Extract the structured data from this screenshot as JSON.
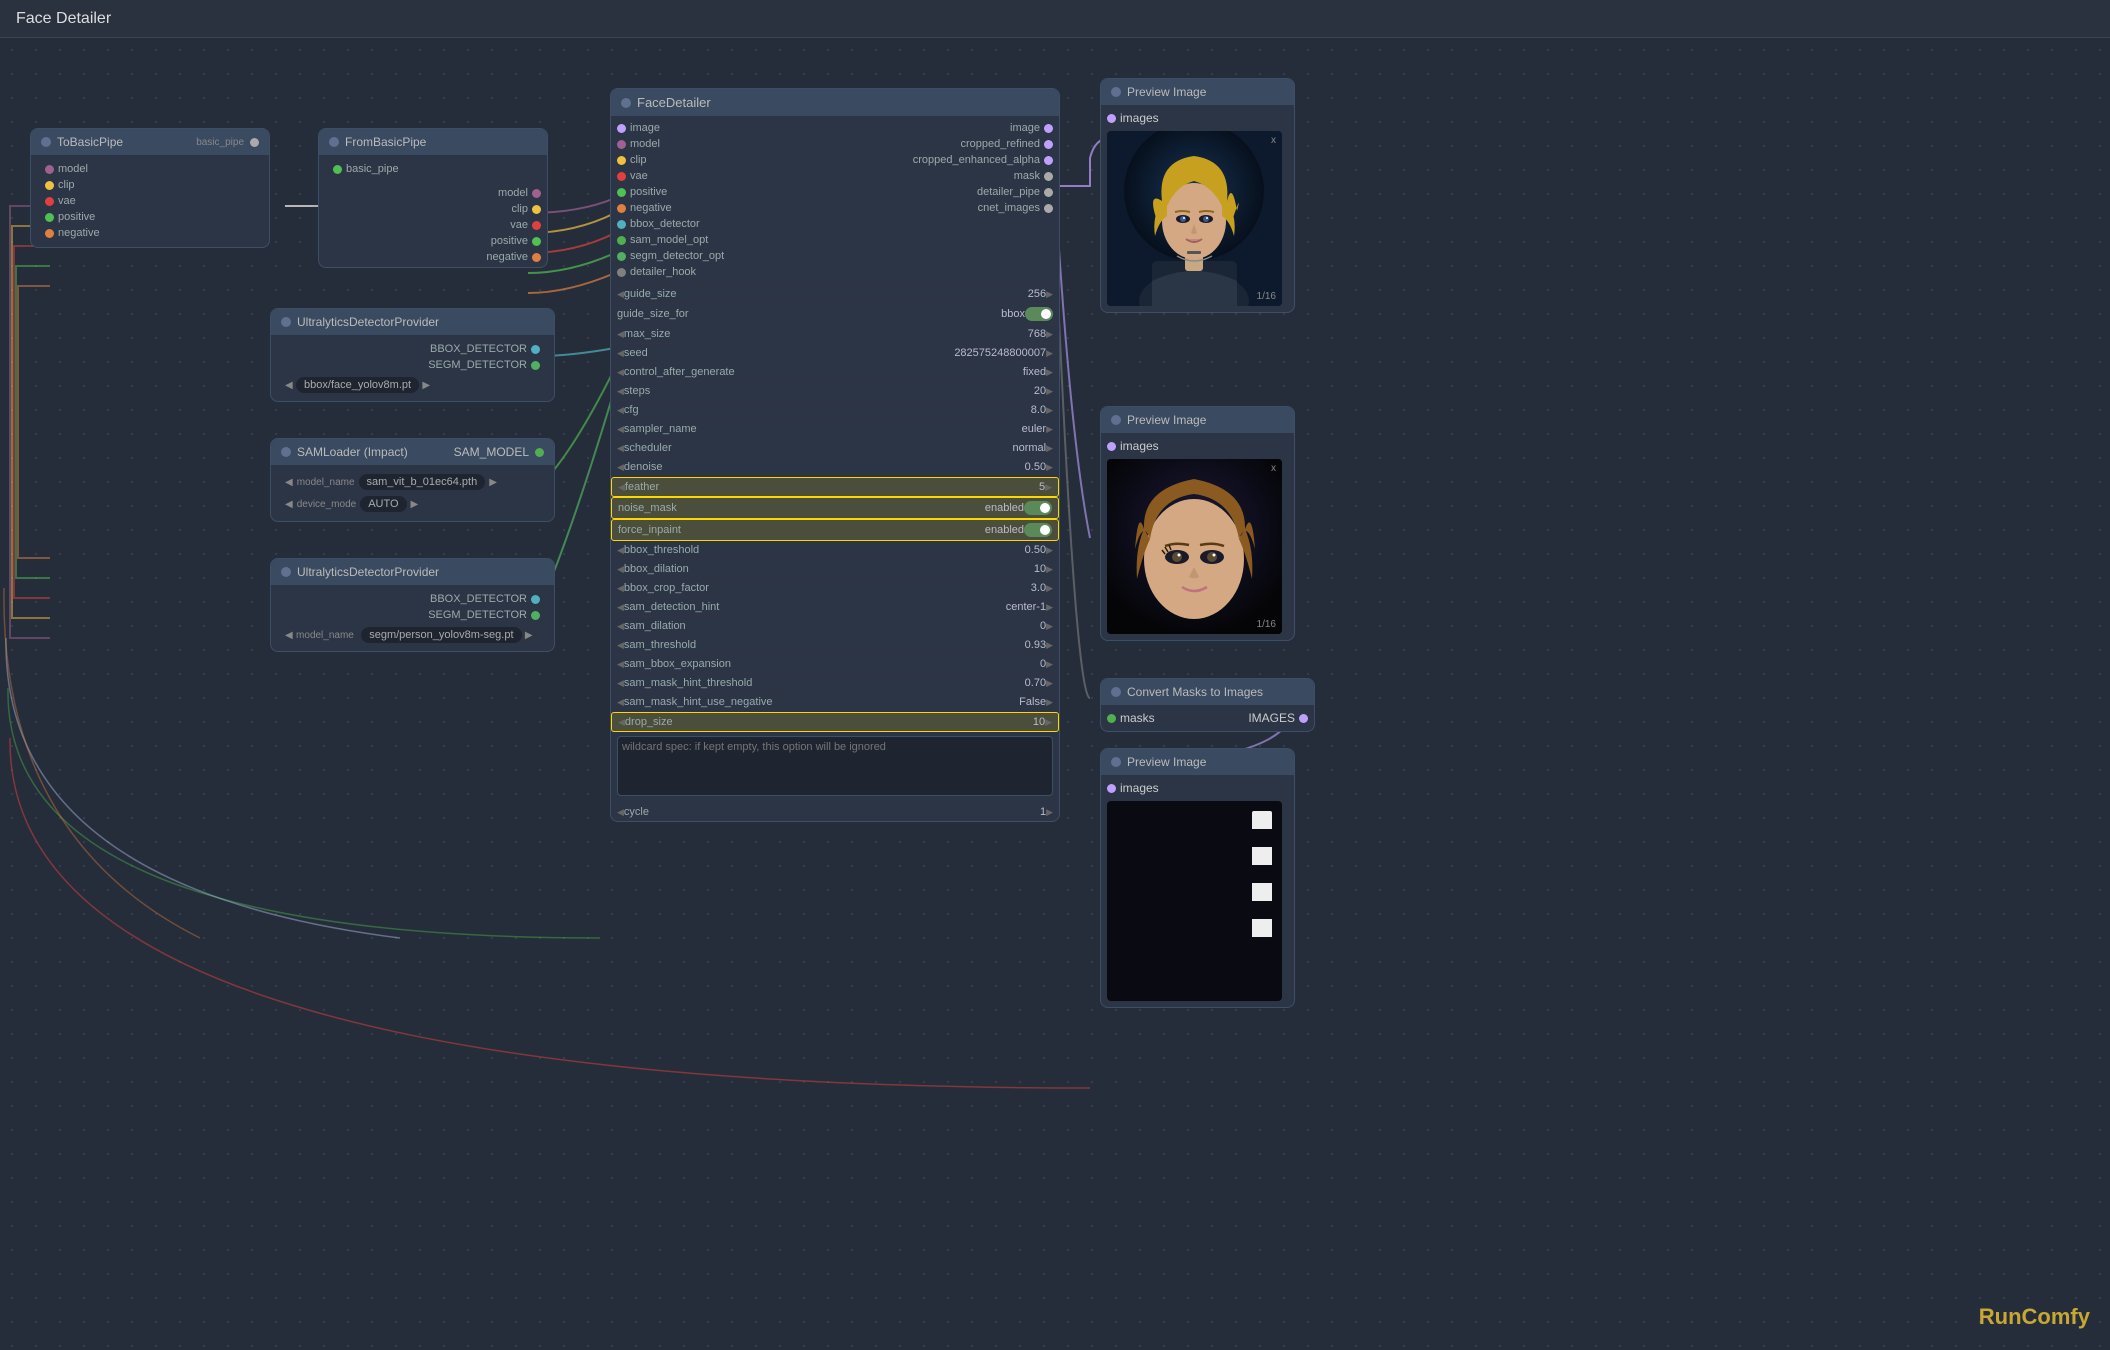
{
  "title": "Face Detailer",
  "watermark": "RunComfy",
  "nodes": {
    "toBasicPipe": {
      "title": "ToBasicPipe",
      "ports": [
        "model",
        "clip",
        "vae",
        "positive",
        "negative"
      ],
      "portColors": [
        "#a06090",
        "#f0c040",
        "#e04040",
        "#50c050",
        "#e08040"
      ],
      "outputPort": "basic_pipe"
    },
    "fromBasicPipe": {
      "title": "FromBasicPipe",
      "inputPort": "basic_pipe",
      "ports": [
        "model",
        "clip",
        "vae",
        "positive",
        "negative"
      ]
    },
    "ultralytics1": {
      "title": "UltralyticsDetectorProvider",
      "outputs": [
        "BBOX_DETECTOR",
        "SEGM_DETECTOR"
      ],
      "modelName": "bbox/face_yolov8m.pt"
    },
    "samLoader": {
      "title": "SAMLoader (Impact)",
      "output": "SAM_MODEL",
      "params": [
        {
          "label": "model_name",
          "value": "sam_vit_b_01ec64.pth"
        },
        {
          "label": "device_mode",
          "value": "AUTO"
        }
      ]
    },
    "ultralytics2": {
      "title": "UltralyticsDetectorProvider",
      "outputs": [
        "BBOX_DETECTOR",
        "SEGM_DETECTOR"
      ],
      "modelName": "segm/person_yolov8m-seg.pt"
    },
    "faceDetailer": {
      "title": "FaceDetailer",
      "leftPorts": [
        "image",
        "model",
        "clip",
        "vae",
        "positive",
        "negative",
        "bbox_detector",
        "sam_model_opt",
        "segm_detector_opt",
        "detailer_hook"
      ],
      "leftPortColors": [
        "#c0a0ff",
        "#a06090",
        "#f0c040",
        "#e04040",
        "#50c050",
        "#e08040",
        "#50b0c0",
        "#50b050",
        "#50b060",
        "#808080"
      ],
      "rightPorts": [
        "image",
        "cropped_refined",
        "cropped_enhanced_alpha",
        "mask",
        "detailer_pipe",
        "cnet_images"
      ],
      "rightPortColors": [
        "#c0a0ff",
        "#c0a0ff",
        "#c0a0ff",
        "#808080",
        "#808080",
        "#808080"
      ],
      "params": [
        {
          "label": "guide_size",
          "value": "256",
          "hasArrows": true
        },
        {
          "label": "guide_size_for",
          "value": "bbox",
          "hasToggle": true
        },
        {
          "label": "max_size",
          "value": "768",
          "hasArrows": true
        },
        {
          "label": "seed",
          "value": "282575248800007",
          "hasArrows": true
        },
        {
          "label": "control_after_generate",
          "value": "fixed",
          "hasArrows": true
        },
        {
          "label": "steps",
          "value": "20",
          "hasArrows": true
        },
        {
          "label": "cfg",
          "value": "8.0",
          "hasArrows": true
        },
        {
          "label": "sampler_name",
          "value": "euler",
          "hasArrows": true
        },
        {
          "label": "scheduler",
          "value": "normal",
          "hasArrows": true
        },
        {
          "label": "denoise",
          "value": "0.50",
          "hasArrows": true
        },
        {
          "label": "feather",
          "value": "5",
          "hasArrows": true,
          "highlighted": true
        },
        {
          "label": "noise_mask",
          "value": "enabled",
          "hasToggle": true,
          "highlighted": true
        },
        {
          "label": "force_inpaint",
          "value": "enabled",
          "hasToggle": true,
          "highlighted": true
        },
        {
          "label": "bbox_threshold",
          "value": "0.50",
          "hasArrows": true
        },
        {
          "label": "bbox_dilation",
          "value": "10",
          "hasArrows": true
        },
        {
          "label": "bbox_crop_factor",
          "value": "3.0",
          "hasArrows": true
        },
        {
          "label": "sam_detection_hint",
          "value": "center-1",
          "hasArrows": true
        },
        {
          "label": "sam_dilation",
          "value": "0",
          "hasArrows": true
        },
        {
          "label": "sam_threshold",
          "value": "0.93",
          "hasArrows": true
        },
        {
          "label": "sam_bbox_expansion",
          "value": "0",
          "hasArrows": true
        },
        {
          "label": "sam_mask_hint_threshold",
          "value": "0.70",
          "hasArrows": true
        },
        {
          "label": "sam_mask_hint_use_negative",
          "value": "False",
          "hasArrows": true
        },
        {
          "label": "drop_size",
          "value": "10",
          "hasArrows": true,
          "highlighted": true
        },
        {
          "label": "wildcard_spec",
          "value": "",
          "isTextarea": true,
          "placeholder": "wildcard spec: if kept empty, this option will be ignored"
        },
        {
          "label": "cycle",
          "value": "1",
          "hasArrows": true
        }
      ]
    },
    "previewImage1": {
      "title": "Preview Image",
      "portLabel": "images",
      "hasImage": true,
      "imageType": "portrait1",
      "counter": "1/16"
    },
    "previewImage2": {
      "title": "Preview Image",
      "portLabel": "images",
      "hasImage": true,
      "imageType": "portrait2",
      "counter": "1/16"
    },
    "convertMasks": {
      "title": "Convert Masks to Images",
      "inputPort": "masks",
      "outputPort": "IMAGES"
    },
    "previewImage3": {
      "title": "Preview Image",
      "portLabel": "images",
      "hasImage": false,
      "imageType": "strip"
    }
  }
}
